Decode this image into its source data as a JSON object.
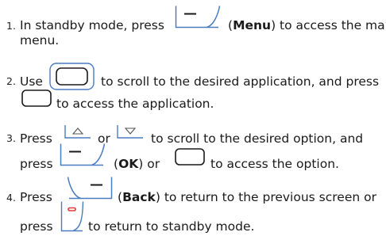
{
  "steps": [
    {
      "number": "1.",
      "parts": [
        "In standby mode, press",
        "(",
        "Menu",
        ") to access the main",
        "menu."
      ]
    },
    {
      "number": "2.",
      "parts": [
        "Use",
        "to scroll to the desired application, and press",
        "to access the application."
      ]
    },
    {
      "number": "3.",
      "parts": [
        "Press",
        "or",
        "to scroll to the desired option, and",
        "press",
        "(",
        "OK",
        ") or",
        "to access the option."
      ]
    },
    {
      "number": "4.",
      "parts": [
        "Press",
        "(",
        "Back",
        ") to return to the previous screen or",
        "press",
        "to return to standby mode."
      ]
    }
  ],
  "icons": {
    "menu_key": "left-soft-key-icon",
    "nav_key": "navigation-key-icon",
    "confirm_key": "confirm-key-icon",
    "up_key": "up-key-icon",
    "down_key": "down-key-icon",
    "back_key": "right-soft-key-icon",
    "end_key": "end-key-icon",
    "stroke_color": "#4a7dc0",
    "end_color": "#e23a3a"
  }
}
